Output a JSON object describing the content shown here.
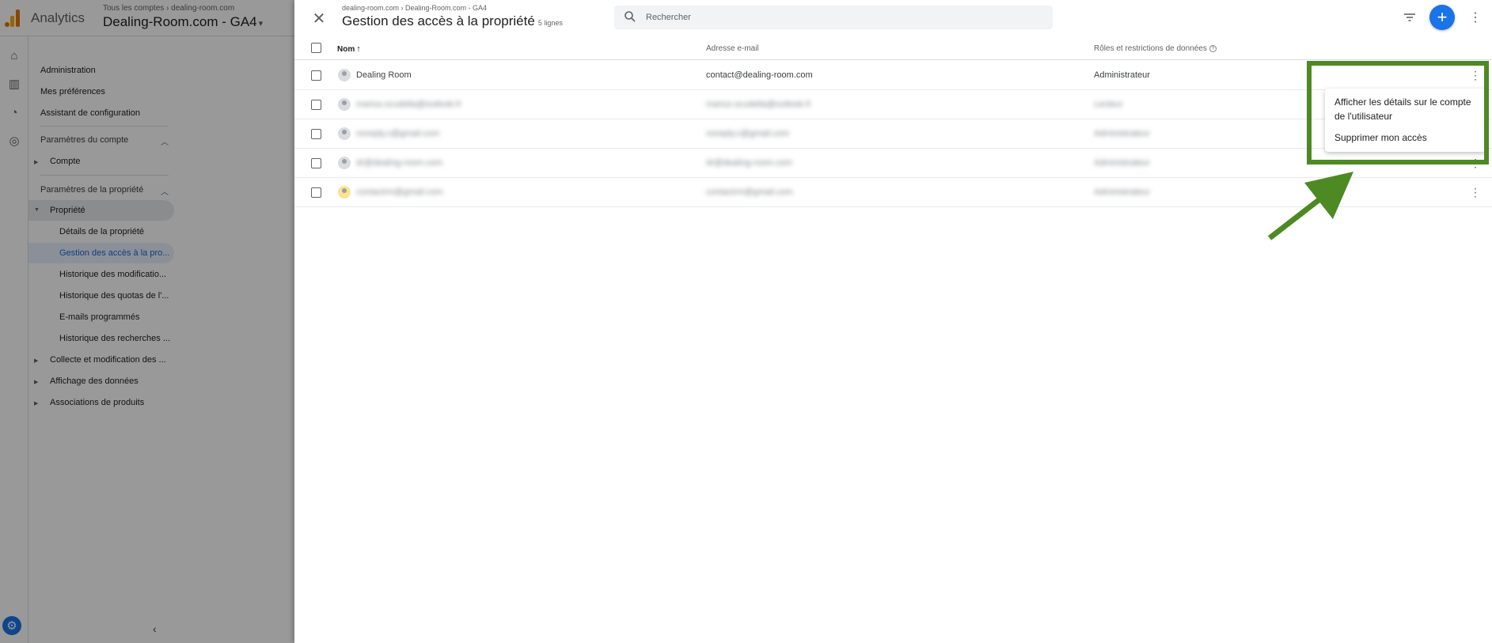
{
  "app": {
    "name": "Analytics",
    "account_crumb": "Tous les comptes › dealing-room.com",
    "property_selector": "Dealing-Room.com - GA4"
  },
  "sidebar": {
    "items": [
      "Administration",
      "Mes préférences",
      "Assistant de configuration"
    ],
    "account_section": "Paramètres du compte",
    "account_child": "Compte",
    "property_section": "Paramètres de la propriété",
    "property_group": "Propriété",
    "property_items": [
      "Détails de la propriété",
      "Gestion des accès à la pro...",
      "Historique des modificatio...",
      "Historique des quotas de l'...",
      "E-mails programmés",
      "Historique des recherches ..."
    ],
    "other_groups": [
      "Collecte et modification des ...",
      "Affichage des données",
      "Associations de produits"
    ]
  },
  "drawer": {
    "breadcrumb": "dealing-room.com › Dealing-Room.com - GA4",
    "title": "Gestion des accès à la propriété",
    "row_count": "5 lignes",
    "search_placeholder": "Rechercher"
  },
  "table": {
    "columns": {
      "name": "Nom",
      "email": "Adresse e-mail",
      "roles": "Rôles et restrictions de données"
    },
    "rows": [
      {
        "name": "Dealing Room",
        "email": "contact@dealing-room.com",
        "role": "Administrateur"
      },
      {
        "name": "marius.scudella@outlook.fr",
        "email": "marius.scudella@outlook.fr",
        "role": "Lecteur"
      },
      {
        "name": "noreply.c@gmail.com",
        "email": "noreply.c@gmail.com",
        "role": "Administrateur"
      },
      {
        "name": "dr@dealing-room.com",
        "email": "dr@dealing-room.com",
        "role": "Administrateur"
      },
      {
        "name": "contactrm@gmail.com",
        "email": "contactrm@gmail.com",
        "role": "Administrateur"
      }
    ]
  },
  "menu": {
    "items": [
      "Afficher les détails sur le compte de l'utilisateur",
      "Supprimer mon accès"
    ]
  },
  "colors": {
    "accent": "#1a73e8",
    "annotation": "#4e8a23"
  },
  "icons": [
    "close-icon",
    "search-icon",
    "filter-icon",
    "add-icon",
    "more-vert-icon",
    "sort-arrow-up-icon",
    "help-icon",
    "gear-icon"
  ]
}
